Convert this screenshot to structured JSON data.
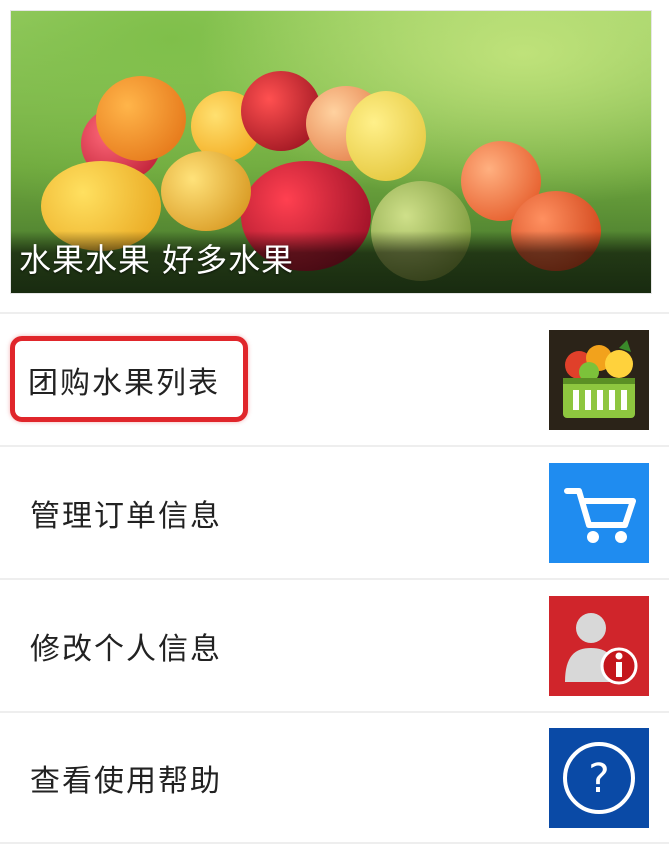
{
  "banner": {
    "caption": "水果水果 好多水果"
  },
  "menu": {
    "items": [
      {
        "label": "团购水果列表",
        "icon": "fruit-basket-icon",
        "color": "#3a2f1e"
      },
      {
        "label": "管理订单信息",
        "icon": "cart-icon",
        "color": "#1f8cf0"
      },
      {
        "label": "修改个人信息",
        "icon": "user-info-icon",
        "color": "#d0252b"
      },
      {
        "label": "查看使用帮助",
        "icon": "help-icon",
        "color": "#0a4aa6"
      }
    ]
  },
  "colors": {
    "highlight": "#e0262b",
    "divider": "#eeeeee"
  }
}
